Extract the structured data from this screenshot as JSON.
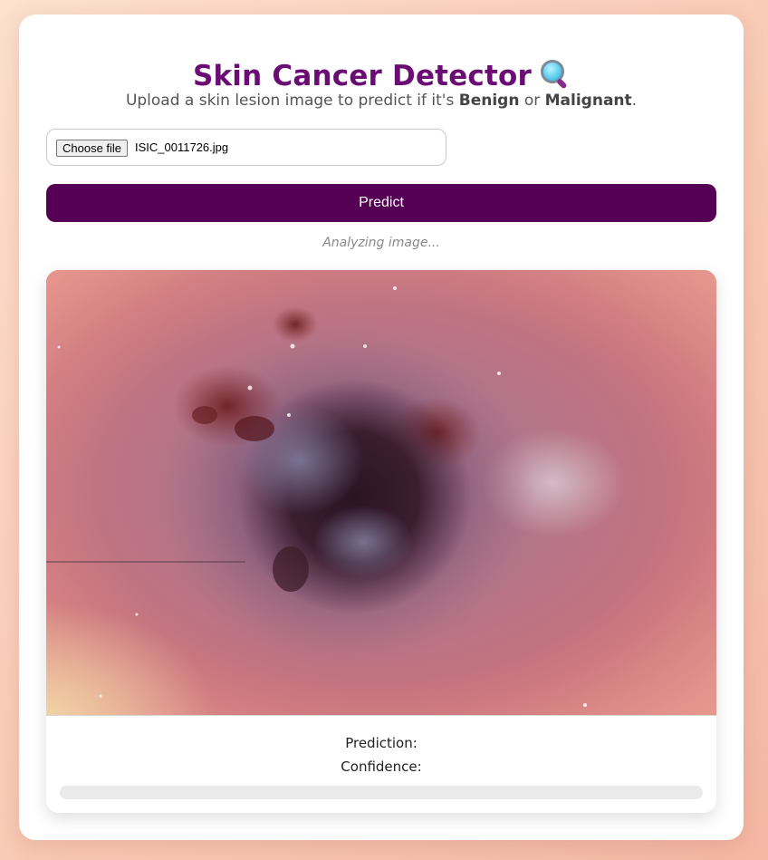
{
  "header": {
    "title": "Skin Cancer Detector",
    "icon": "magnifying-glass-icon",
    "subtitle_prefix": "Upload a skin lesion image to predict if it's ",
    "subtitle_benign": "Benign",
    "subtitle_or": " or ",
    "subtitle_malignant": "Malignant",
    "subtitle_suffix": "."
  },
  "upload": {
    "choose_label": "Choose file",
    "file_name": "ISIC_0011726.jpg"
  },
  "actions": {
    "predict_label": "Predict"
  },
  "status": {
    "text": "Analyzing image..."
  },
  "result": {
    "prediction_label": "Prediction:",
    "prediction_value": "",
    "confidence_label": "Confidence:",
    "confidence_value": "",
    "confidence_fraction": 0
  },
  "colors": {
    "accent": "#6a0c74",
    "button": "#550055",
    "background_top": "#fde0cf",
    "background_bottom": "#f4b8a3"
  }
}
